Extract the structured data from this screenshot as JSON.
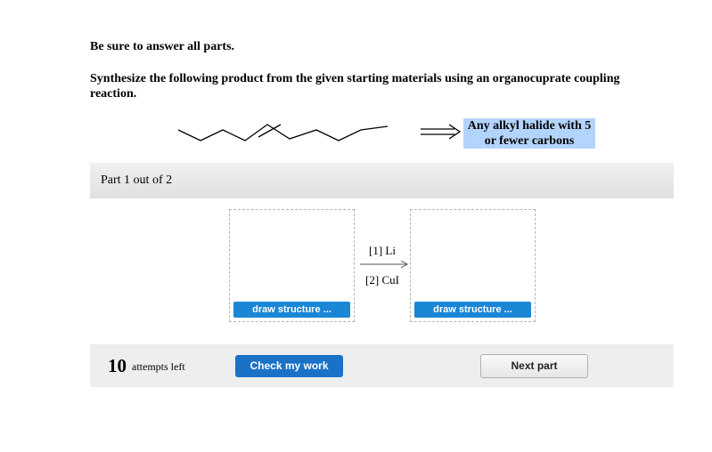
{
  "instructions": {
    "line1": "Be sure to answer all parts.",
    "line2": "Synthesize the following product from the given starting materials using an organocuprate coupling reaction."
  },
  "scheme": {
    "product_icon": "skeletal-alkene-structure",
    "arrow_icon": "retrosynthesis-arrow-icon",
    "starting_material": "Any alkyl halide with 5 or fewer carbons",
    "highlight_color": "#b3d4fc"
  },
  "part": {
    "title": "Part 1 out of 2"
  },
  "reaction": {
    "step1": "[1] Li",
    "step2": "[2] CuI",
    "draw_left_label": "draw structure ...",
    "draw_right_label": "draw structure ..."
  },
  "footer": {
    "attempts_count": "10",
    "attempts_label": "attempts left",
    "check_label": "Check my work",
    "next_label": "Next part"
  },
  "colors": {
    "primary_button": "#1a72c7",
    "draw_button": "#1a86d6"
  }
}
